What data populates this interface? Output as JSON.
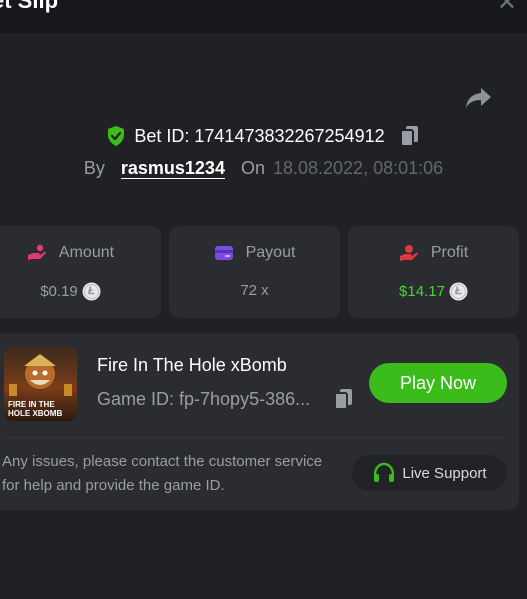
{
  "window": {
    "title": "et Slip",
    "close_icon": "close-icon"
  },
  "share": {
    "icon": "share-arrow-icon"
  },
  "bet": {
    "id_label": "Bet ID: 1741473832267254912",
    "by_label": "By",
    "username": "rasmus1234",
    "on_label": "On",
    "datetime": "18.08.2022, 08:01:06"
  },
  "stats": {
    "amount": {
      "label": "Amount",
      "value": "$0.19",
      "icon": "amount-hand-icon"
    },
    "payout": {
      "label": "Payout",
      "value": "72 x",
      "icon": "card-icon"
    },
    "profit": {
      "label": "Profit",
      "value": "$14.17",
      "icon": "profit-hand-icon"
    }
  },
  "game": {
    "name": "Fire In The Hole xBomb",
    "id_label": "Game ID: fp-7hopy5-386...",
    "play_label": "Play Now",
    "thumb_title_1": "FIRE IN THE",
    "thumb_title_2": "HOLE XBOMB"
  },
  "support": {
    "message": "Any issues, please contact the customer service for help and provide the game ID.",
    "button_label": "Live Support"
  },
  "colors": {
    "background": "#1f2124",
    "card": "#2a2c30",
    "accent_green": "#3cbc1b",
    "profit_green": "#4cd137",
    "payout_purple": "#7b4ce0",
    "amount_pink": "#e0387a",
    "profit_red": "#e0383e"
  }
}
